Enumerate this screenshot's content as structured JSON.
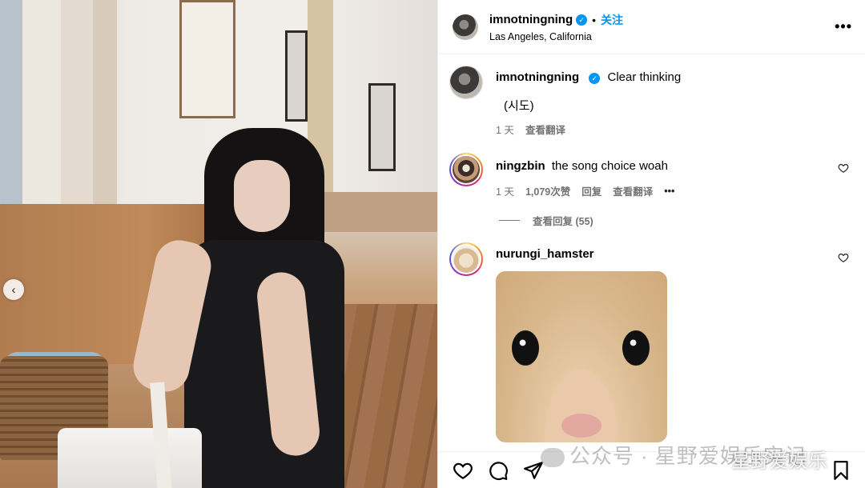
{
  "post": {
    "carousel_prev_glyph": "‹",
    "author": {
      "username": "imnotningning",
      "verified": true,
      "follow_label": "关注",
      "location": "Las Angeles, California"
    },
    "more_glyph": "•••"
  },
  "comments": [
    {
      "username": "imnotningning",
      "text": "Clear thinking",
      "subtext": "(시도)",
      "time": "1 天",
      "translate": "查看翻译"
    },
    {
      "username": "ningzbin",
      "text": "the song choice woah",
      "time": "1 天",
      "likes": "1,079次赞",
      "reply": "回复",
      "translate": "查看翻译",
      "options_glyph": "•••",
      "view_replies": "查看回复 (55)"
    },
    {
      "username": "nurungi_hamster",
      "text": ""
    }
  ],
  "watermark": {
    "source": "公众号",
    "name": "星野爱娱乐实记",
    "overlay": "星野爱娱乐"
  },
  "icons": {
    "like": "heart-icon",
    "comment": "comment-icon",
    "share": "share-icon",
    "save": "bookmark-icon"
  },
  "colors": {
    "accent": "#0095f6",
    "meta_gray": "#737373"
  }
}
